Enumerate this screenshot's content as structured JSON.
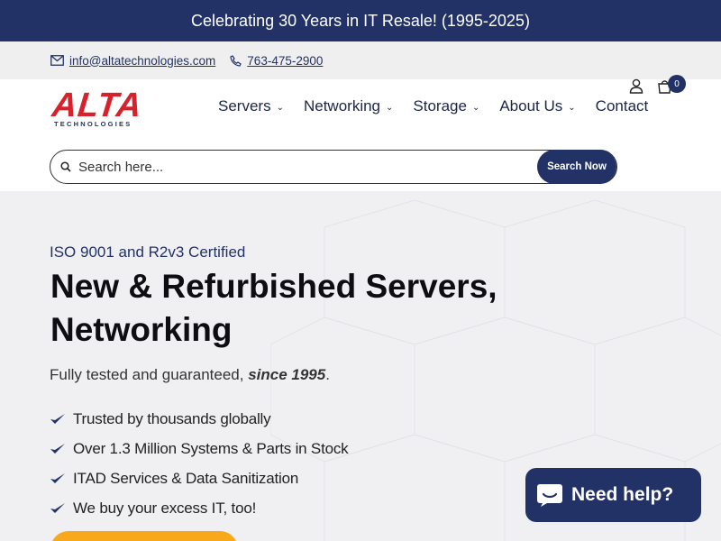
{
  "announcement": "Celebrating 30 Years in IT Resale! (1995-2025)",
  "contact": {
    "email": "info@altatechnologies.com",
    "phone": "763-475-2900"
  },
  "logo": {
    "name": "ALTA",
    "tagline": "TECHNOLOGIES"
  },
  "nav": [
    {
      "label": "Servers",
      "dropdown": true
    },
    {
      "label": "Networking",
      "dropdown": true
    },
    {
      "label": "Storage",
      "dropdown": true
    },
    {
      "label": "About Us",
      "dropdown": true
    },
    {
      "label": "Contact",
      "dropdown": false
    }
  ],
  "search": {
    "placeholder": "Search here...",
    "button": "Search Now"
  },
  "cart": {
    "count": "0"
  },
  "hero": {
    "certification": "ISO 9001 and R2v3 Certified",
    "headline": "New & Refurbished Servers, Networking",
    "subtitle_prefix": "Fully tested and guaranteed, ",
    "subtitle_emphasis": "since 1995",
    "subtitle_suffix": ".",
    "bullets": [
      "Trusted by thousands globally",
      "Over 1.3 Million Systems & Parts in Stock",
      "ITAD Services & Data Sanitization",
      "We buy your excess IT, too!"
    ]
  },
  "chat": {
    "label": "Need help?"
  },
  "colors": {
    "brand_navy": "#233266",
    "brand_red": "#d8222b",
    "cta_orange": "#f7a81b"
  }
}
